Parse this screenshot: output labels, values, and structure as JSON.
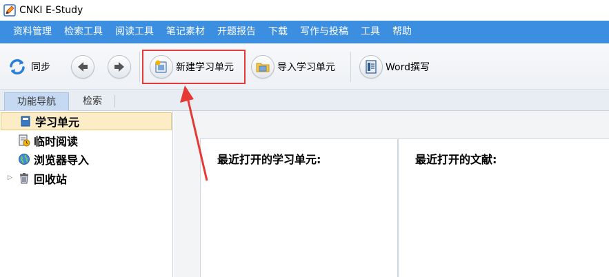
{
  "window": {
    "title": "CNKI E-Study"
  },
  "menubar": {
    "items": [
      "资料管理",
      "检索工具",
      "阅读工具",
      "笔记素材",
      "开题报告",
      "下载",
      "写作与投稿",
      "工具",
      "帮助"
    ]
  },
  "toolbar": {
    "sync_label": "同步",
    "new_unit_label": "新建学习单元",
    "import_unit_label": "导入学习单元",
    "word_label": "Word撰写"
  },
  "tabs": {
    "items": [
      "功能导航",
      "检索"
    ]
  },
  "sidebar": {
    "items": [
      "学习单元",
      "临时阅读",
      "浏览器导入",
      "回收站"
    ]
  },
  "main": {
    "recent_units_title": "最近打开的学习单元:",
    "recent_docs_title": "最近打开的文献:"
  },
  "colors": {
    "menubar": "#3c8fe0",
    "annotation": "#e53935",
    "selected_item": "#fcedc6"
  }
}
